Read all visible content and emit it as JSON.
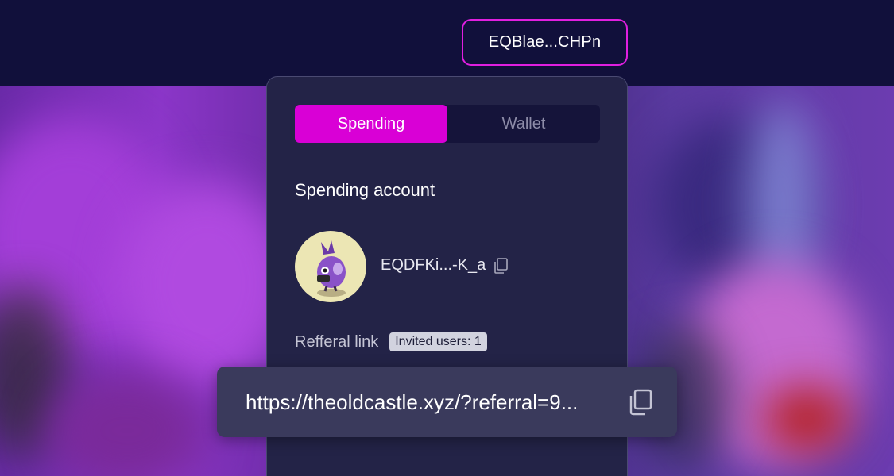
{
  "header": {
    "wallet_address": "EQBlae...CHPn"
  },
  "tabs": [
    {
      "label": "Spending",
      "active": true
    },
    {
      "label": "Wallet",
      "active": false
    }
  ],
  "account": {
    "title": "Spending account",
    "address": "EQDFKi...-K_a",
    "avatar_icon": "purple-bird-avatar"
  },
  "referral": {
    "label": "Refferal link",
    "invited_badge": "Invited users: 1",
    "link": "https://theoldcastle.xyz/?referral=9..."
  },
  "colors": {
    "accent": "#d900d6",
    "panel": "#232347",
    "header": "#11103b",
    "link_box": "#3a3a5c"
  }
}
